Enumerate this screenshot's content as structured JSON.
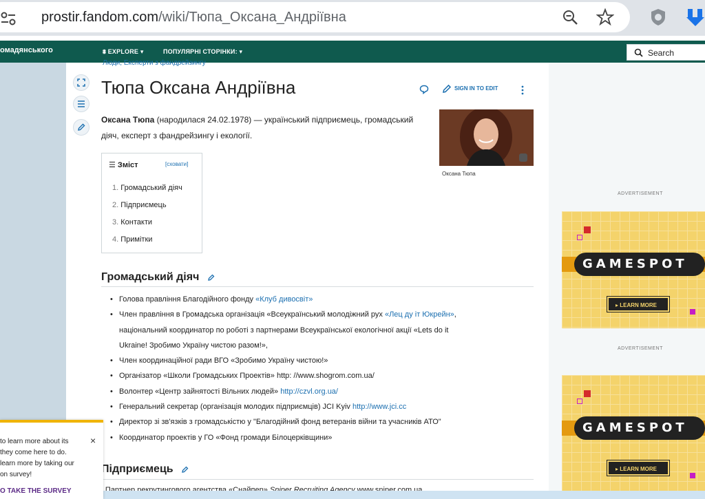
{
  "browser": {
    "url_host": "prostir.fandom.com",
    "url_path": "/wiki/Тюпа_Оксана_Андріївна"
  },
  "nav": {
    "wiki_name": "омадянського",
    "explore": "EXPLORE",
    "popular": "ПОПУЛЯРНІ СТОРІНКИ:",
    "search_label": "Search"
  },
  "article": {
    "breadcrumb": "Люди, Експерти з фандрейзингу",
    "title": "Тюпа Оксана Андріївна",
    "sign_in_to_edit": "SIGN IN TO EDIT",
    "intro_bold": "Оксана Тюпа",
    "intro_rest": " (народилася 24.02.1978) — український підприємець, громадський діяч, експерт з фандрейзингу і екології.",
    "photo_caption": "Оксана Тюпа",
    "toc": {
      "title": "Зміст",
      "hide": "[сховати]",
      "items": [
        {
          "num": "1.",
          "label": "Громадський діяч"
        },
        {
          "num": "2.",
          "label": "Підприємець"
        },
        {
          "num": "3.",
          "label": "Контакти"
        },
        {
          "num": "4.",
          "label": "Примітки"
        }
      ]
    },
    "section1": "Громадський діяч",
    "section2": "Підприємець",
    "bullets": [
      {
        "pre": "Голова правління Благодійного фонду ",
        "link": "«Клуб дивосвіт»",
        "post": ""
      },
      {
        "pre": "Член правління в Громадська організація «Всеукраїнський молодіжний рух ",
        "link": "«Лец ду іт Юкрейн»",
        "post": ","
      },
      {
        "pre": "національний координатор по роботі з партнерами Всеукраїнської екологічної акції «Lets do it",
        "link": "",
        "post": "",
        "cont": true
      },
      {
        "pre": "Ukraine! Зробимо Україну чистою разом!»,",
        "link": "",
        "post": "",
        "cont": true
      },
      {
        "pre": "Член координаційної ради ВГО «Зробимо Україну чистою!»",
        "link": "",
        "post": ""
      },
      {
        "pre": "Організатор «Школи Громадських Проектів» http: //www.shogrom.com.ua/",
        "link": "",
        "post": ""
      },
      {
        "pre": "Волонтер «Центр зайнятості Вільних людей» ",
        "link": "http://czvl.org.ua/",
        "post": ""
      },
      {
        "pre": "Генеральний секретар (організація молодих підприємців) JCI Kyiv ",
        "link": "http://www.jci.cc",
        "post": ""
      },
      {
        "pre": "Директор зі зв'язків з громадськістю у \"Благодійний фонд ветеранів війни та учасників АТО\"",
        "link": "",
        "post": ""
      },
      {
        "pre": "Координатор проектів у ГО «Фонд громади Білоцерківщини»",
        "link": "",
        "post": ""
      }
    ],
    "bottom_line_pre": "• Партнер рекрутингового агентства «Снайпер» ",
    "bottom_line_em": "Sniper Recruiting Agency",
    "bottom_line_post": " www.sniper.com.ua"
  },
  "ads": {
    "label": "ADVERTISEMENT",
    "brand": "GAMESPOT",
    "cta": "▸ LEARN MORE"
  },
  "survey": {
    "line1": "to learn more about its",
    "line2": "they come here to do.",
    "line3": "learn more by taking our",
    "line4": "on survey!",
    "cta": "O TAKE THE SURVEY",
    "close": "×"
  },
  "icons": [
    "site-info-icon",
    "zoom-icon",
    "star-icon",
    "shield-extension-icon",
    "download-extension-icon",
    "explore-icon",
    "search-icon",
    "expand-icon",
    "toc-list-icon",
    "edit-icon",
    "talk-icon",
    "pencil-icon",
    "kebab-icon",
    "close-icon"
  ],
  "colors": {
    "nav_green": "#0f5a4e",
    "link_blue": "#1b6fb0",
    "ad_yellow": "#f4d36b",
    "survey_gold": "#f0b400"
  }
}
